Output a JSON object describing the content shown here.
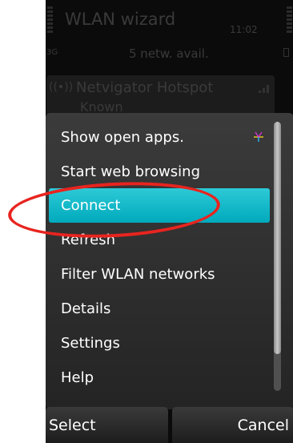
{
  "header": {
    "title": "WLAN wizard",
    "clock": "11:02",
    "network_type": "3G",
    "status": "5 netw. avail."
  },
  "background_list": {
    "items": [
      {
        "name": "Netvigator Hotspot",
        "status": "Known"
      }
    ]
  },
  "menu": {
    "items": [
      {
        "label": "Show open apps."
      },
      {
        "label": "Start web browsing"
      },
      {
        "label": "Connect"
      },
      {
        "label": "Refresh"
      },
      {
        "label": "Filter WLAN networks"
      },
      {
        "label": "Details"
      },
      {
        "label": "Settings"
      },
      {
        "label": "Help"
      }
    ],
    "selected_index": 2
  },
  "softkeys": {
    "left": "Select",
    "right": "Cancel"
  },
  "colors": {
    "selected": "#00aabc",
    "annotation": "#e8241f",
    "apps_icon": "#cc33cc"
  }
}
